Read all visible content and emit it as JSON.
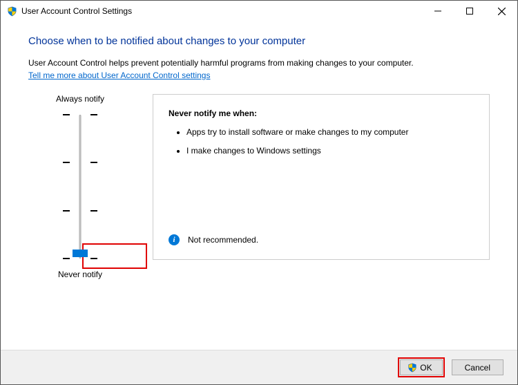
{
  "window": {
    "title": "User Account Control Settings"
  },
  "heading": "Choose when to be notified about changes to your computer",
  "description": "User Account Control helps prevent potentially harmful programs from making changes to your computer.",
  "link_text": "Tell me more about User Account Control settings",
  "slider": {
    "top_label": "Always notify",
    "bottom_label": "Never notify"
  },
  "info": {
    "title": "Never notify me when:",
    "items": [
      "Apps try to install software or make changes to my computer",
      "I make changes to Windows settings"
    ],
    "footer": "Not recommended."
  },
  "buttons": {
    "ok": "OK",
    "cancel": "Cancel"
  }
}
